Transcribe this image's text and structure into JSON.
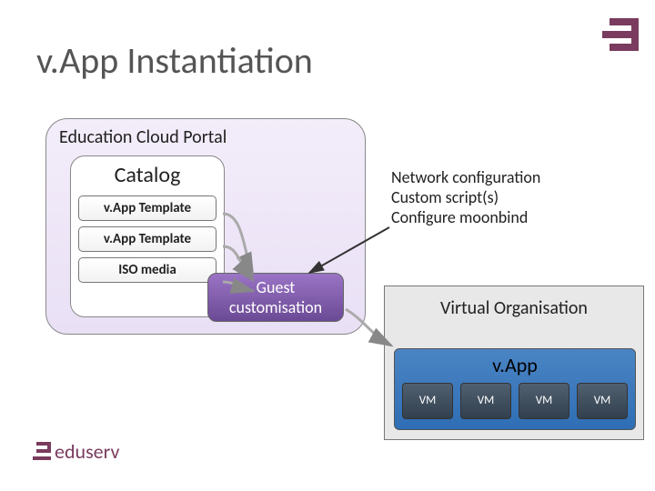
{
  "title": "v.App Instantiation",
  "portal": {
    "title": "Education Cloud Portal",
    "catalog": {
      "title": "Catalog",
      "items": [
        {
          "label": "v.App Template"
        },
        {
          "label": "v.App Template"
        },
        {
          "label": "ISO media"
        }
      ]
    }
  },
  "guest": {
    "line1": "Guest",
    "line2": "customisation"
  },
  "config": {
    "line1": "Network configuration",
    "line2": "Custom script(s)",
    "line3": "Configure moonbind"
  },
  "vo": {
    "title": "Virtual Organisation",
    "vapp": {
      "title": "v.App",
      "vms": [
        {
          "label": "VM"
        },
        {
          "label": "VM"
        },
        {
          "label": "VM"
        },
        {
          "label": "VM"
        }
      ]
    }
  },
  "brand": "eduserv"
}
